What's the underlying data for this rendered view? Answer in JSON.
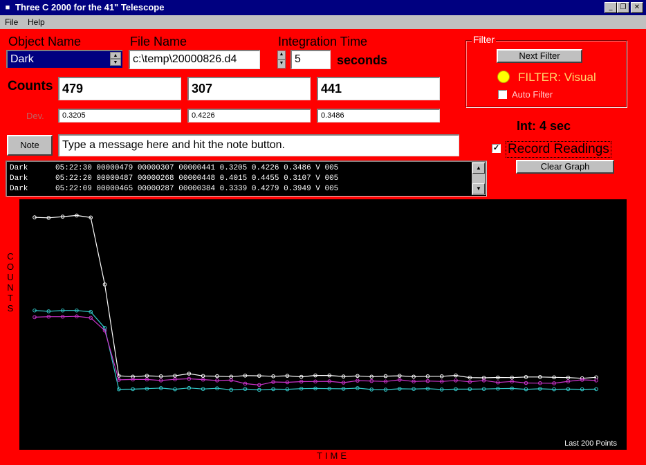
{
  "window": {
    "title": "Three C 2000 for the 41\" Telescope",
    "app_icon": "telescope-app-icon",
    "controls": [
      "minimize-icon",
      "restore-icon",
      "close-icon"
    ],
    "minimize_glyph": "_",
    "restore_glyph": "❐",
    "close_glyph": "✕"
  },
  "menu": {
    "items": [
      "File",
      "Help"
    ]
  },
  "object": {
    "label": "Object Name",
    "value": "Dark"
  },
  "file": {
    "label": "File Name",
    "value": "c:\\temp\\20000826.d4"
  },
  "integration": {
    "label": "Integration Time",
    "value": "5",
    "unit": "seconds"
  },
  "counts": {
    "label": "Counts",
    "values": [
      "479",
      "307",
      "441"
    ]
  },
  "dev": {
    "label": "Dev.",
    "values": [
      "0.3205",
      "0.4226",
      "0.3486"
    ]
  },
  "note": {
    "button": "Note",
    "placeholder": "Type a message here and hit the note button."
  },
  "filter": {
    "title": "Filter",
    "next_button": "Next Filter",
    "status": "FILTER: Visual",
    "indicator_color": "#ffff00",
    "auto_label": "Auto Filter",
    "auto_checked": false
  },
  "int_status": "Int:  4 sec",
  "record": {
    "label": "Record Readings",
    "checked": true
  },
  "clear_graph": "Clear Graph",
  "log": {
    "lines": [
      "Dark      05:22:30 00000479 00000307 00000441 0.3205 0.4226 0.3486 V 005",
      "Dark      05:22:20 00000487 00000268 00000448 0.4015 0.4455 0.3107 V 005",
      "Dark      05:22:09 00000465 00000287 00000384 0.3339 0.4279 0.3949 V 005"
    ]
  },
  "graph": {
    "ylabel": "COUNTS",
    "xlabel": "TIME",
    "note": "Last 200 Points"
  },
  "colors": {
    "background": "#ff0000",
    "series_white": "#ffffff",
    "series_cyan": "#33cccc",
    "series_magenta": "#cc33cc"
  },
  "chart_data": {
    "type": "line",
    "ylabel": "COUNTS",
    "xlabel": "TIME",
    "ylim": [
      0,
      1500
    ],
    "x": [
      1,
      2,
      3,
      4,
      5,
      6,
      7,
      8,
      9,
      10,
      11,
      12,
      13,
      14,
      15,
      16,
      17,
      18,
      19,
      20,
      21,
      22,
      23,
      24,
      25,
      26,
      27,
      28,
      29,
      30,
      31,
      32,
      33,
      34,
      35,
      36,
      37,
      38,
      39,
      40,
      41
    ],
    "series": [
      {
        "color": "#ffffff",
        "values": [
          1392,
          1389,
          1396,
          1403,
          1391,
          990,
          443,
          438,
          443,
          440,
          443,
          456,
          442,
          441,
          438,
          444,
          443,
          440,
          443,
          437,
          445,
          445,
          439,
          442,
          438,
          441,
          443,
          438,
          440,
          440,
          445,
          432,
          431,
          433,
          432,
          436,
          436,
          434,
          432,
          428,
          434
        ]
      },
      {
        "color": "#33cccc",
        "values": [
          834,
          829,
          834,
          834,
          826,
          730,
          362,
          363,
          366,
          369,
          362,
          370,
          364,
          368,
          359,
          364,
          359,
          363,
          362,
          366,
          367,
          366,
          365,
          369,
          361,
          360,
          365,
          364,
          366,
          361,
          363,
          363,
          364,
          366,
          367,
          362,
          365,
          362,
          363,
          362,
          363
        ]
      },
      {
        "color": "#cc33cc",
        "values": [
          794,
          797,
          797,
          799,
          790,
          714,
          419,
          421,
          421,
          415,
          422,
          425,
          420,
          415,
          417,
          396,
          388,
          406,
          404,
          408,
          409,
          410,
          402,
          414,
          412,
          409,
          419,
          409,
          412,
          409,
          415,
          407,
          415,
          403,
          409,
          400,
          399,
          398,
          410,
          419,
          415
        ]
      }
    ]
  }
}
